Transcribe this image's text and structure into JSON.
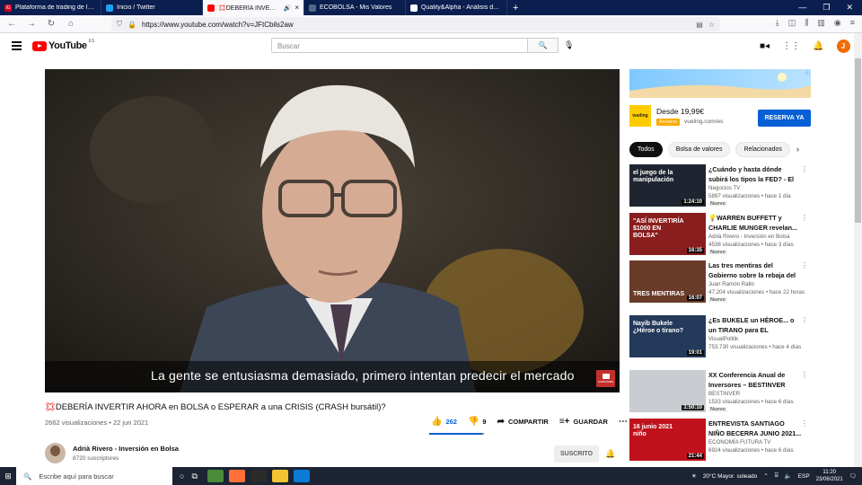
{
  "browser": {
    "tabs": [
      {
        "title": "Plataforma de trading de IG | C",
        "icon_color": "#d0021b",
        "icon_text": "IG",
        "active": false
      },
      {
        "title": "Inicio / Twitter",
        "icon_color": "#1da1f2",
        "icon_text": "",
        "active": false
      },
      {
        "title": "💢DEBERÍA INVERTIR AHORA",
        "icon_color": "#ff0000",
        "icon_text": "",
        "active": true
      },
      {
        "title": "ECOBOLSA - Mis Valores",
        "icon_color": "#4a6b8a",
        "icon_text": "",
        "active": false
      },
      {
        "title": "Quality&Alpha - Análisis de em",
        "icon_color": "#ffffff",
        "icon_text": "",
        "active": false
      }
    ],
    "new_tab": "+",
    "url": "https://www.youtube.com/watch?v=JFtCbils2aw"
  },
  "header": {
    "logo_text": "YouTube",
    "country": "ES",
    "search_placeholder": "Buscar",
    "avatar_letter": "J"
  },
  "player": {
    "subtitle": "La gente se entusiasma demasiado, primero intentan predecir el mercado",
    "badge": "SUBSCRIBE"
  },
  "video": {
    "title": "💢DEBERÍA INVERTIR AHORA en BOLSA o ESPERAR a una CRISIS (CRASH bursátil)?",
    "meta": "2662 visualizaciones • 22 jun 2021",
    "likes": "262",
    "dislikes": "9",
    "like_ratio": 0.967,
    "share_label": "COMPARTIR",
    "save_label": "GUARDAR"
  },
  "channel": {
    "name": "Adrià Rivero - Inversión en Bolsa",
    "subscribers": "8720 suscriptores",
    "subscribe_label": "SUSCRITO"
  },
  "ad": {
    "logo": "vueling",
    "price": "Desde 19,99€",
    "tag": "Anuncio",
    "domain": "vueling.com/es",
    "cta": "RESERVA YA"
  },
  "chips": [
    "Todos",
    "Bolsa de valores",
    "Relacionados"
  ],
  "recommendations": [
    {
      "title": "¿Cuándo y hasta dónde subirá los tipos la FED? - El Juego d...",
      "channel": "Negocios TV",
      "views": "5897 visualizaciones • hace 1 día",
      "badge": "Nuevo",
      "duration": "1:24:10",
      "thumb_text": "el juego de la manipulación",
      "thumb_color": "#1f2530"
    },
    {
      "title": "💡WARREN BUFFETT y CHARLIE MUNGER revelan...",
      "channel": "Adrià Rivero - Inversión en Bolsa",
      "views": "4538 visualizaciones • hace 3 días",
      "badge": "Nuevo",
      "duration": "16:35",
      "thumb_text": "\"ASÍ INVERTIRÍA $1000 EN BOLSA\"",
      "thumb_color": "#8a1e1e"
    },
    {
      "title": "Las tres mentiras del Gobierno sobre la rebaja del IVA de la...",
      "channel": "Juan Ramón Rallo",
      "views": "47.204 visualizaciones • hace 22 horas",
      "badge": "Nuevo",
      "duration": "16:07",
      "thumb_text": "TRES MENTIRAS",
      "thumb_color": "#6b3b2a"
    },
    {
      "title": "¿Es BUKELE un HÉROE... o un TIRANO para EL SALVADOR?...",
      "channel": "VisualPolitik",
      "views": "753.730 visualizaciones • hace 4 días",
      "badge": "",
      "duration": "19:01",
      "thumb_text": "Nayib Bukele ¿Héroe o tirano?",
      "thumb_color": "#243a5a"
    },
    {
      "title": "XX Conferencia Anual de Inversores – BESTINVER",
      "channel": "BESTINVER",
      "views": "1533 visualizaciones • hace 6 días",
      "badge": "Nuevo",
      "duration": "1:50:10",
      "thumb_text": "",
      "thumb_color": "#c9ccd1"
    },
    {
      "title": "ENTREVISTA SANTIAGO NIÑO BECERRA JUNIO 2021...",
      "channel": "ECONOMÍA FUTURA TV",
      "views": "6924 visualizaciones • hace 6 días",
      "badge": "",
      "duration": "21:44",
      "thumb_text": "16 junio 2021 niño",
      "thumb_color": "#c0121c"
    }
  ],
  "taskbar": {
    "search_placeholder": "Escribe aquí para buscar",
    "weather": "20°C  Mayor. soleado",
    "lang": "ESP",
    "time": "11:20",
    "date": "23/06/2021"
  }
}
